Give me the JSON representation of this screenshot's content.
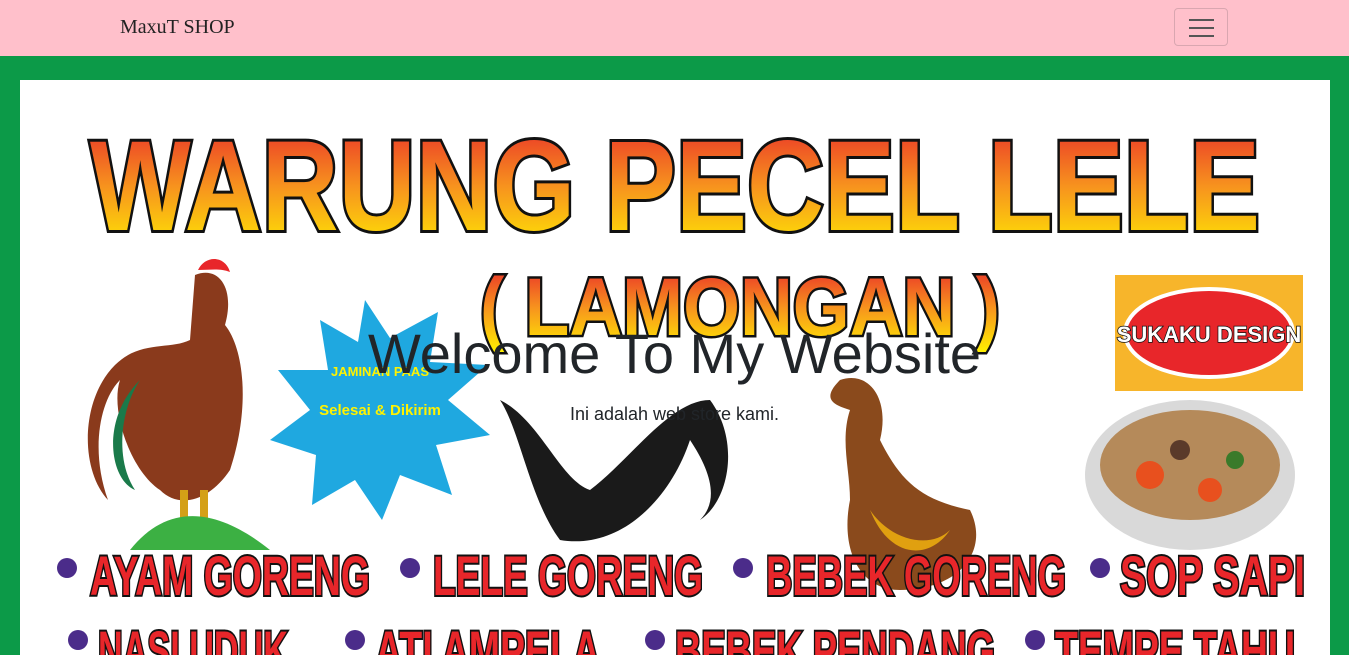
{
  "navbar": {
    "brand": "MaxuT SHOP",
    "toggle_icon": "hamburger-icon",
    "bg": "#ffc0cb"
  },
  "banner": {
    "headline": "WARUNG PECEL LELE",
    "subheadline": "( LAMONGAN )",
    "badge": {
      "line1": "JAMINAN PAAS",
      "line2": "Selesai & Dikirim"
    },
    "logo": "SUKAKU DESIGN",
    "menu": [
      "AYAM GORENG",
      "LELE GORENG",
      "BEBEK GORENG",
      "SOP SAPI",
      "NASI UDUK",
      "ATI AMPELA",
      "BEBEK PENDANG",
      "TEMPE TAHU"
    ],
    "border_color": "#0c9a48"
  },
  "hero": {
    "title": "Welcome To My Website",
    "subtitle": "Ini adalah web store kami."
  }
}
